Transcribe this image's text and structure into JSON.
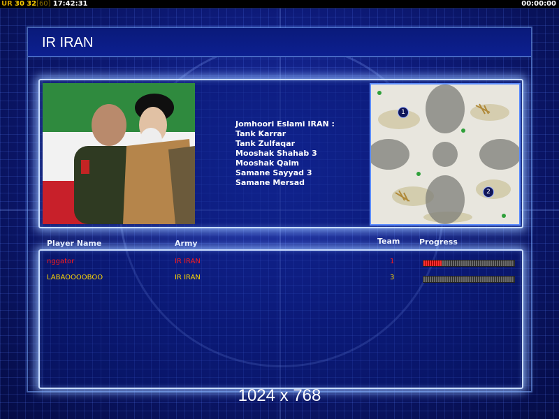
{
  "status_bar": {
    "ur_label": "UR",
    "fps_value": "30",
    "fps_current": "32",
    "fps_bracket": "[60]",
    "clock": "17:42:31",
    "timer": "00:00:00"
  },
  "title": "IR IRAN",
  "army_info": {
    "header": "Jomhoori Eslami IRAN :",
    "units": [
      "Tank Karrar",
      "Tank Zulfaqar",
      "Mooshak Shahab 3",
      "Mooshak Qaim",
      "Samane Sayyad 3",
      "Samane Mersad"
    ]
  },
  "minimap": {
    "start_positions": [
      "1",
      "2"
    ]
  },
  "players_table": {
    "columns": {
      "name": "Player Name",
      "army": "Army",
      "team": "Team",
      "progress": "Progress"
    },
    "rows": [
      {
        "name": "nggator",
        "army": "IR IRAN",
        "team": "1",
        "progress": 0.2,
        "color": "#ff1a1a"
      },
      {
        "name": "LABAOOOOBOO",
        "army": "IR IRAN",
        "team": "3",
        "progress": 0.0,
        "color": "#ffd800"
      }
    ]
  },
  "resolution": "1024 x 768",
  "colors": {
    "background": "#0d1a78",
    "panel_glow": "#c8dcff",
    "player1": "#ff1a1a",
    "player2": "#ffd800"
  }
}
